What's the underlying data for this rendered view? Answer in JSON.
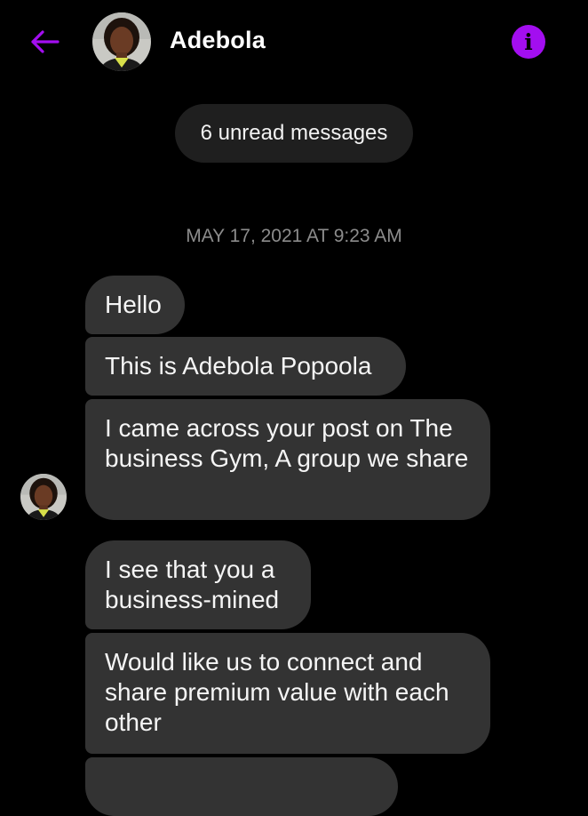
{
  "header": {
    "contact_name": "Adebola",
    "icons": {
      "back": "arrow-left-icon",
      "info": "info-icon"
    },
    "accent_color": "#a30ef0"
  },
  "conversation": {
    "unread_pill": "6 unread messages",
    "timestamp": "MAY 17, 2021 AT 9:23 AM",
    "messages": [
      {
        "text": "Hello"
      },
      {
        "text": "This is Adebola Popoola"
      },
      {
        "text": "I came across your post on The business Gym, A group we share"
      },
      {
        "text": "I see that you a business-mined"
      },
      {
        "text": "Would like us to connect and share premium value with each other"
      },
      {
        "text": ""
      }
    ]
  },
  "colors": {
    "background": "#000000",
    "bubble": "#333333",
    "pill": "#1f1f1f",
    "timestamp": "#8c8c8c"
  }
}
